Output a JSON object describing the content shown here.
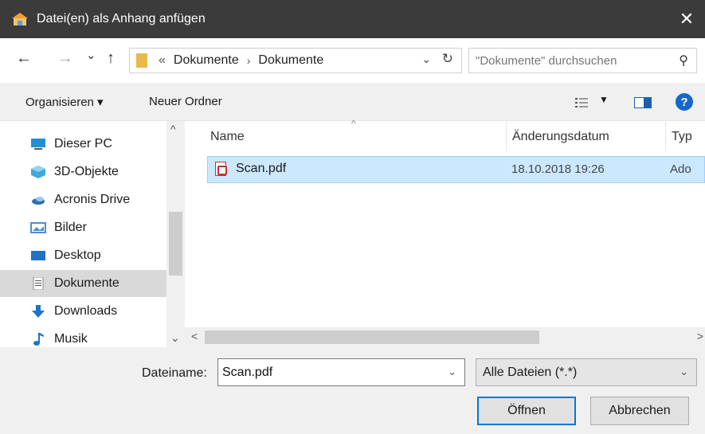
{
  "window": {
    "title": "Datei(en) als Anhang anfügen",
    "close_label": "✕"
  },
  "address": {
    "back_label": "←",
    "forward_label": "→",
    "recent_label": "⌄",
    "up_label": "↑",
    "overflow_label": "«",
    "crumbs": [
      "Dokumente",
      "Dokumente"
    ],
    "separator": "›",
    "dropdown_label": "⌄",
    "refresh_label": "↻"
  },
  "search": {
    "placeholder": "\"Dokumente\" durchsuchen",
    "icon_label": "⚲"
  },
  "toolbar": {
    "organize_label": "Organisieren ▾",
    "new_folder_label": "Neuer Ordner",
    "view_dropdown_label": "▼",
    "help_label": "?"
  },
  "navigation": {
    "scroll_up": "^",
    "scroll_down": "⌄",
    "items": [
      {
        "label": "Dieser PC",
        "icon": "computer-icon",
        "color": "#1e90d8"
      },
      {
        "label": "3D-Objekte",
        "icon": "3d-objects-icon",
        "color": "#3fa9d8"
      },
      {
        "label": "Acronis Drive",
        "icon": "drive-icon",
        "color": "#2f6fb3"
      },
      {
        "label": "Bilder",
        "icon": "pictures-icon",
        "color": "#4a8fd0"
      },
      {
        "label": "Desktop",
        "icon": "desktop-icon",
        "color": "#1e73c9"
      },
      {
        "label": "Dokumente",
        "icon": "documents-icon",
        "color": "#8c8c8c"
      },
      {
        "label": "Downloads",
        "icon": "downloads-icon",
        "color": "#1e73c9"
      },
      {
        "label": "Musik",
        "icon": "music-icon",
        "color": "#1e73c9"
      }
    ],
    "selected_label": "Dokumente"
  },
  "files": {
    "columns": [
      "Name",
      "Änderungsdatum",
      "Typ"
    ],
    "sort_indicator": "^",
    "scroll_left": "<",
    "scroll_right": ">",
    "rows": [
      {
        "name": "Scan.pdf",
        "date": "18.10.2018 19:26",
        "type": "Ado"
      }
    ]
  },
  "bottom": {
    "filename_label": "Dateiname:",
    "filename_value": "Scan.pdf",
    "filename_dropdown": "⌄",
    "filter_value": "Alle Dateien (*.*)",
    "filter_dropdown": "⌄",
    "open_label": "Öffnen",
    "cancel_label": "Abbrechen"
  },
  "colors": {
    "titlebar": "#3b3b3b",
    "selection": "#cce8ff",
    "accent": "#0078d7"
  }
}
